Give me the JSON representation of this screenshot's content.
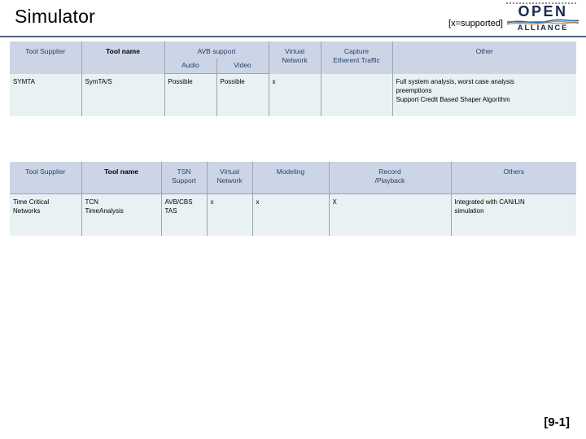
{
  "slide": {
    "title": "Simulator",
    "legend_note": "[x=supported]",
    "page_number": "[9-1]"
  },
  "logo": {
    "line1": "OPEN",
    "line2": "ALLIANCE",
    "color_text": "#1a2a4a",
    "color_wave_blue": "#2f6fa8",
    "color_wave_orange": "#e08a2e"
  },
  "table_avb": {
    "headers": {
      "tool_supplier": "Tool Supplier",
      "tool_name": "Tool name",
      "avb_support": "AVB support",
      "audio": "Audio",
      "video": "Video",
      "virtual_network": "Virtual\nNetwork",
      "virtual_network_l1": "Virtual",
      "virtual_network_l2": "Network",
      "capture_l1": "Capture",
      "capture_l2": "Etherent Traffic",
      "other": "Other"
    },
    "rows": [
      {
        "tool_supplier": "SYMTA",
        "tool_name": "SymTA/S",
        "audio": "Possible",
        "video": "Possible",
        "virtual_network": "x",
        "capture_ethernet_traffic": "",
        "other": "Full system analysis, worst case analysis\npreemptions\nSupport Credit Based Shaper Algorithm"
      }
    ]
  },
  "table_tsn": {
    "headers": {
      "tool_supplier": "Tool Supplier",
      "tool_name": "Tool name",
      "tsn_support_l1": "TSN",
      "tsn_support_l2": "Support",
      "virtual_network_l1": "Virtual",
      "virtual_network_l2": "Network",
      "modeling": "Modeling",
      "record_l1": "Record",
      "record_l2": "/Playback",
      "others": "Others"
    },
    "rows": [
      {
        "tool_supplier": "Time Critical\nNetworks",
        "tool_name": "TCN\nTimeAnalysis",
        "tsn_support": "AVB/CBS\nTAS",
        "virtual_network": "x",
        "modeling": "x",
        "record_playback": "X",
        "others": "Integrated with CAN/LIN\nsimulation"
      }
    ]
  },
  "colors": {
    "header_bg": "#ccd5e6",
    "header_text": "#27406b",
    "row_bg": "#e9f1f3",
    "rule": "#4a6484",
    "border": "#9aa4b4"
  }
}
